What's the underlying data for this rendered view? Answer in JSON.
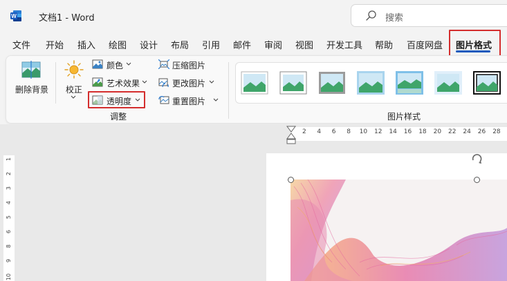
{
  "app": {
    "title": "文档1  -  Word",
    "search_placeholder": "搜索"
  },
  "menu": {
    "tabs": [
      "文件",
      "开始",
      "插入",
      "绘图",
      "设计",
      "布局",
      "引用",
      "邮件",
      "审阅",
      "视图",
      "开发工具",
      "帮助",
      "百度网盘",
      "图片格式"
    ],
    "active": "图片格式"
  },
  "ribbon": {
    "remove_bg": "删除背景",
    "corrections": "校正",
    "color": "颜色",
    "artistic": "艺术效果",
    "transparency": "透明度",
    "compress": "压缩图片",
    "change": "更改图片",
    "reset": "重置图片",
    "adjust_group": "调整",
    "styles_group": "图片样式"
  },
  "ruler": {
    "h_numbers": [
      "2",
      "4",
      "6",
      "8",
      "10",
      "12",
      "14",
      "16",
      "18",
      "20",
      "22",
      "24",
      "26",
      "28"
    ],
    "v_numbers": [
      "1",
      "2",
      "3",
      "4",
      "5",
      "6",
      "8",
      "9",
      "10"
    ]
  },
  "colors": {
    "accent": "#185abd",
    "highlight": "#d42d2d",
    "word_blue": "#185abd"
  }
}
